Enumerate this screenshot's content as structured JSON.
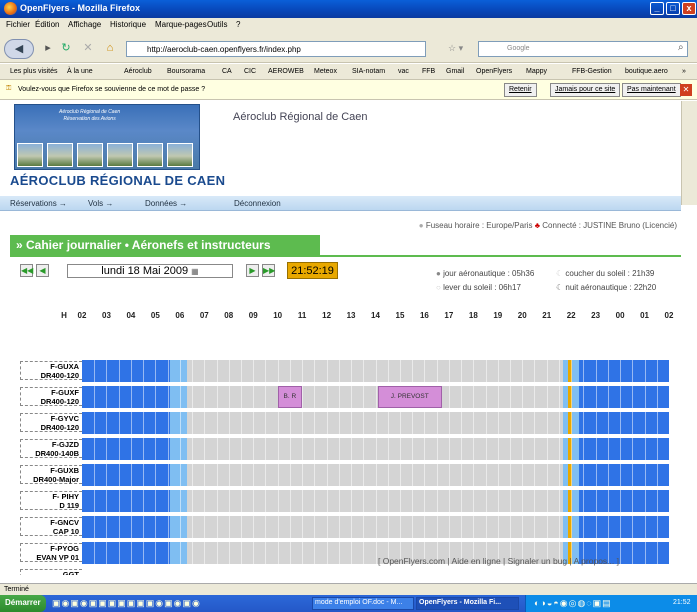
{
  "window": {
    "title": "OpenFlyers - Mozilla Firefox",
    "buttons": [
      "_",
      "□",
      "x"
    ]
  },
  "menu": [
    "Fichier",
    "Édition",
    "Affichage",
    "Historique",
    "Marque-pages",
    "Outils",
    "?"
  ],
  "nav": {
    "url": "http://aeroclub-caen.openflyers.fr/index.php",
    "search_placeholder": "Google"
  },
  "bookmarks": [
    "Les plus visités",
    "À la une",
    "Aéroclub",
    "Boursorama",
    "CA",
    "CIC",
    "AEROWEB",
    "Meteox",
    "SIA-notam",
    "vac",
    "FFB",
    "Gmail",
    "OpenFlyers",
    "Mappy",
    "FFB-Gestion",
    "boutique.aero",
    "»"
  ],
  "notification": {
    "text": "Voulez-vous que Firefox se souvienne de ce mot de passe ?",
    "btn1": "Retenir",
    "btn2": "Jamais pour ce site",
    "btn3": "Pas maintenant"
  },
  "banner": {
    "line1": "Aéroclub Régional de Caen",
    "line2": "Réservation des Avions"
  },
  "site_title": "Aéroclub Régional de Caen",
  "club_name": "AÉROCLUB RÉGIONAL DE CAEN",
  "main_menu": [
    "Réservations →",
    "Vols →",
    "Données →",
    "Déconnexion"
  ],
  "info": {
    "timezone": "Fuseau horaire : Europe/Paris",
    "connected": "Connecté : JUSTINE Bruno  (Licencié)"
  },
  "header_title": "» Cahier journalier • Aéronefs et instructeurs",
  "date": "lundi 18 Mai 2009",
  "time": "21:52:19",
  "sun": {
    "jour": "jour aéronautique : 05h36",
    "lever": "lever du soleil : 06h17",
    "coucher": "coucher du soleil : 21h39",
    "nuit": "nuit aéronautique : 22h20"
  },
  "hour_header": "H",
  "hours": [
    "02",
    "03",
    "04",
    "05",
    "06",
    "07",
    "08",
    "09",
    "10",
    "11",
    "12",
    "13",
    "14",
    "15",
    "16",
    "17",
    "18",
    "19",
    "20",
    "21",
    "22",
    "23",
    "00",
    "01",
    "02"
  ],
  "aircraft": [
    {
      "reg": "F-GUXA",
      "type": "DR400-120"
    },
    {
      "reg": "F-GUXF",
      "type": "DR400-120"
    },
    {
      "reg": "F-GYVC",
      "type": "DR400-120"
    },
    {
      "reg": "F-GJZD",
      "type": "DR400-140B"
    },
    {
      "reg": "F-GUXB",
      "type": "DR400-Major"
    },
    {
      "reg": "F- PIHY",
      "type": "D 119"
    },
    {
      "reg": "F-GNCV",
      "type": "CAP 10"
    },
    {
      "reg": "F-PYOG",
      "type": "EVAN VP 01"
    },
    {
      "reg": "GGT",
      "type": ""
    }
  ],
  "bookings": [
    {
      "row": 1,
      "start": 10.0,
      "end": 11.0,
      "label": "B. R"
    },
    {
      "row": 1,
      "start": 14.1,
      "end": 16.7,
      "label": "J. PREVOST"
    }
  ],
  "footer": "[ OpenFlyers.com  |  Aide en ligne  |  Signaler un bug  |  A propos...  ]",
  "status": "Terminé",
  "taskbar": {
    "start": "Démarrer",
    "tasks": [
      "mode d'emploi OF.doc - M...",
      "OpenFlyers - Mozilla Fi..."
    ],
    "clock": "21:52"
  },
  "colors": {
    "night": "#2f73e6",
    "twilight": "#7fbef2",
    "day": "#d4d4d4",
    "now": "#e8a800",
    "booking": "#d48ed8"
  }
}
